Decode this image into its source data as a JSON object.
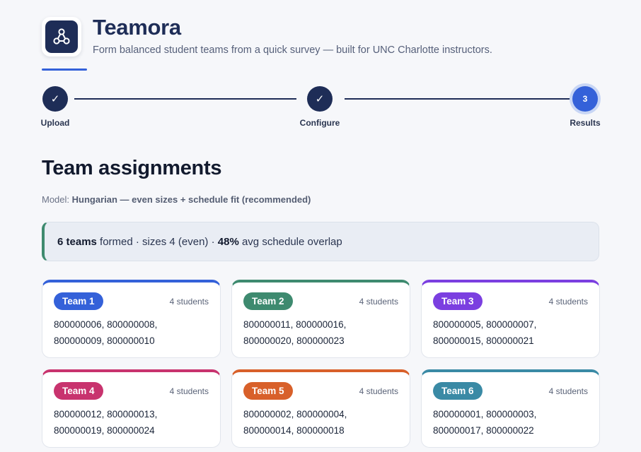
{
  "app": {
    "name": "Teamora",
    "tagline": "Form balanced student teams from a quick survey — built for UNC Charlotte instructors.",
    "logo_icon": "team-network-icon"
  },
  "stepper": {
    "steps": [
      {
        "label": "Upload",
        "state": "done",
        "marker": "✓"
      },
      {
        "label": "Configure",
        "state": "done",
        "marker": "✓"
      },
      {
        "label": "Results",
        "state": "active",
        "marker": "3"
      }
    ]
  },
  "results": {
    "title": "Team assignments",
    "model_prefix": "Model:",
    "model_name": "Hungarian — even sizes + schedule fit (recommended)",
    "summary": {
      "teams_count": "6 teams",
      "formed_text": " formed · sizes 4 (even) · ",
      "overlap_value": "48%",
      "overlap_text": " avg schedule overlap"
    },
    "teams": [
      {
        "name": "Team 1",
        "count": "4 students",
        "members": "800000006, 800000008, 800000009, 800000010",
        "color": "#3461d9"
      },
      {
        "name": "Team 2",
        "count": "4 students",
        "members": "800000011, 800000016, 800000020, 800000023",
        "color": "#3e8a6f"
      },
      {
        "name": "Team 3",
        "count": "4 students",
        "members": "800000005, 800000007, 800000015, 800000021",
        "color": "#7b3fe0"
      },
      {
        "name": "Team 4",
        "count": "4 students",
        "members": "800000012, 800000013, 800000019, 800000024",
        "color": "#c8336e"
      },
      {
        "name": "Team 5",
        "count": "4 students",
        "members": "800000002, 800000004, 800000014, 800000018",
        "color": "#d8602a"
      },
      {
        "name": "Team 6",
        "count": "4 students",
        "members": "800000001, 800000003, 800000017, 800000022",
        "color": "#3a8aa5"
      }
    ]
  }
}
